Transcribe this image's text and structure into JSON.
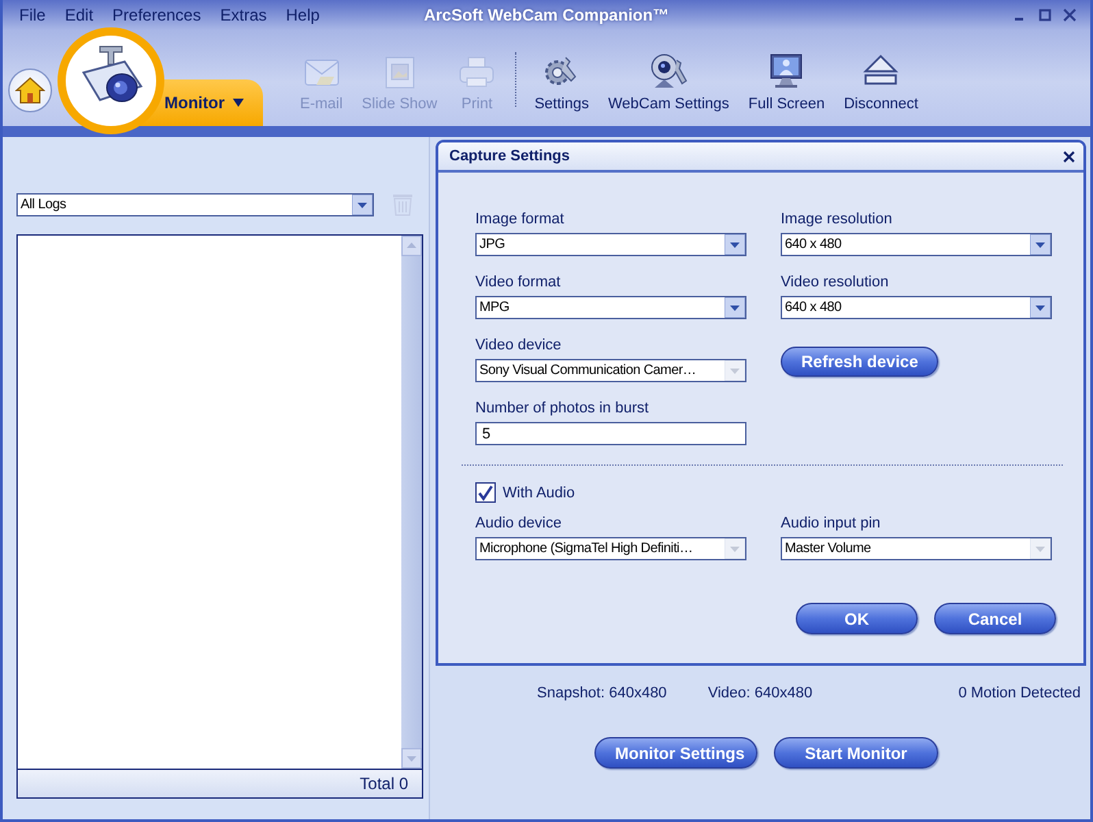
{
  "window": {
    "title": "ArcSoft WebCam Companion™"
  },
  "menu": [
    "File",
    "Edit",
    "Preferences",
    "Extras",
    "Help"
  ],
  "mode_tab": {
    "label": "Monitor"
  },
  "toolbar": [
    {
      "label": "E-mail",
      "kind": "email",
      "disabled": true
    },
    {
      "label": "Slide Show",
      "kind": "slideshow",
      "disabled": true
    },
    {
      "label": "Print",
      "kind": "print",
      "disabled": true
    },
    {
      "label": "Settings",
      "kind": "settings",
      "disabled": false
    },
    {
      "label": "WebCam Settings",
      "kind": "webcam",
      "disabled": false
    },
    {
      "label": "Full Screen",
      "kind": "fullscreen",
      "disabled": false
    },
    {
      "label": "Disconnect",
      "kind": "eject",
      "disabled": false
    }
  ],
  "log_panel": {
    "filter": "All Logs",
    "total": "Total 0"
  },
  "dialog": {
    "title": "Capture Settings",
    "fields": [
      {
        "kind": "dropdown",
        "label": "Image format",
        "value": "JPG",
        "disabled": false
      },
      {
        "kind": "dropdown",
        "label": "Image resolution",
        "value": "640 x 480",
        "disabled": false
      },
      {
        "kind": "dropdown",
        "label": "Video format",
        "value": "MPG",
        "disabled": false
      },
      {
        "kind": "dropdown",
        "label": "Video resolution",
        "value": "640 x 480",
        "disabled": false
      },
      {
        "kind": "dropdown",
        "label": "Video device",
        "value": "Sony Visual Communication Camer…",
        "disabled": true
      },
      {
        "kind": "button",
        "label": "Refresh device"
      },
      {
        "kind": "text",
        "label": "Number of photos in burst",
        "value": "5"
      }
    ],
    "with_audio": {
      "label": "With Audio",
      "checked": true
    },
    "audio_fields": [
      {
        "kind": "dropdown",
        "label": "Audio device",
        "value": "Microphone (SigmaTel High Definiti…",
        "disabled": true
      },
      {
        "kind": "dropdown",
        "label": "Audio input pin",
        "value": "Master Volume",
        "disabled": true
      }
    ],
    "buttons": [
      "OK",
      "Cancel"
    ]
  },
  "status": {
    "snapshot": "Snapshot: 640x480",
    "video": "Video: 640x480",
    "motion": "0 Motion Detected"
  },
  "actions": [
    "Monitor Settings",
    "Start Monitor"
  ]
}
